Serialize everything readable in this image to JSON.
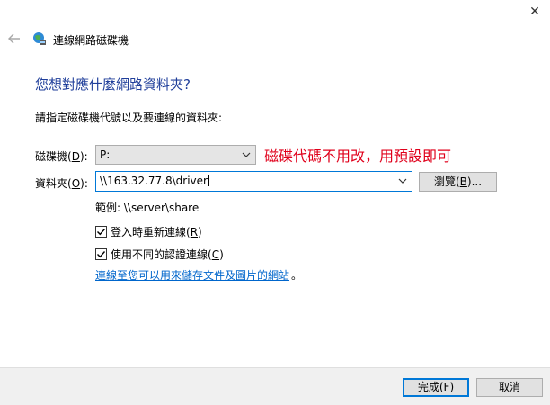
{
  "window": {
    "title": "連線網路磁碟機",
    "close_glyph": "✕"
  },
  "heading": "您想對應什麼網路資料夾?",
  "instruction": "請指定磁碟機代號以及要連線的資料夾:",
  "drive": {
    "label": "磁碟機",
    "hotkey": "D",
    "value": "P:"
  },
  "annotation": "磁碟代碼不用改，用預設即可",
  "folder": {
    "label": "資料夾",
    "hotkey": "O",
    "value": "\\\\163.32.77.8\\driver"
  },
  "browse": {
    "label": "瀏覽",
    "hotkey": "B",
    "suffix": "..."
  },
  "example": "範例: \\\\server\\share",
  "options": {
    "reconnect": {
      "label": "登入時重新連線",
      "hotkey": "R",
      "checked": true
    },
    "credentials": {
      "label": "使用不同的認證連線",
      "hotkey": "C",
      "checked": true
    }
  },
  "link": {
    "text": "連線至您可以用來儲存文件及圖片的網站",
    "trailing": "。"
  },
  "footer": {
    "finish": {
      "label": "完成",
      "hotkey": "F"
    },
    "cancel": {
      "label": "取消"
    }
  },
  "colors": {
    "heading": "#1f3e9a",
    "annotation": "#e0001b",
    "link": "#0066cc",
    "focus": "#0078d7"
  },
  "icons": {
    "back": "back-arrow-icon",
    "network": "network-drive-icon",
    "dropdown": "chevron-down-icon",
    "check": "checkmark-icon"
  }
}
